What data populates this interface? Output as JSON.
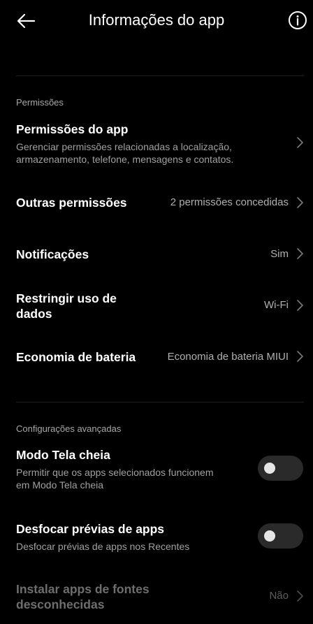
{
  "header": {
    "back_icon": "arrow-left-icon",
    "title": "Informações do app",
    "info_icon": "info-circle-icon"
  },
  "sections": {
    "permissions": {
      "label": "Permissões",
      "items": {
        "app_permissions": {
          "title": "Permissões do app",
          "subtitle_line1": "Gerenciar permissões relacionadas a localização,",
          "subtitle_line2": "armazenamento, telefone, mensagens e contatos."
        },
        "other_permissions": {
          "title": "Outras permissões",
          "value": "2 permissões concedidas"
        },
        "notifications": {
          "title": "Notificações",
          "value": "Sim"
        },
        "data_usage": {
          "title_line1": "Restringir uso de",
          "title_line2": "dados",
          "value": "Wi-Fi"
        },
        "battery_saver": {
          "title": "Economia de bateria",
          "value": "Economia de bateria MIUI"
        }
      }
    },
    "advanced": {
      "label": "Configurações avançadas",
      "items": {
        "fullscreen": {
          "title": "Modo Tela cheia",
          "subtitle_line1": "Permitir que os apps selecionados funcionem",
          "subtitle_line2": "em Modo Tela cheia",
          "enabled": false
        },
        "blur_previews": {
          "title": "Desfocar prévias de apps",
          "subtitle": "Desfocar prévias de apps nos Recentes",
          "enabled": false
        },
        "unknown_sources": {
          "title_line1": "Instalar apps de fontes",
          "title_line2": "desconhecidas",
          "value": "Não"
        }
      }
    }
  },
  "colors": {
    "background": "#000000",
    "primary_text": "#ffffff",
    "secondary_text": "#a0a0a0",
    "toggle_track": "#2a2a2a",
    "divider": "#1f1f1f"
  }
}
